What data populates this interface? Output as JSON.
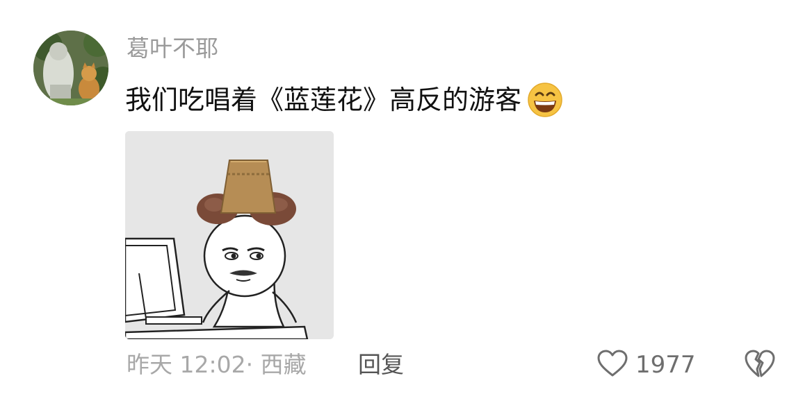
{
  "comment": {
    "username": "葛叶不耶",
    "text": "我们吃唱着《蓝莲花》高反的游客",
    "emoji": "grinning-face-emoji",
    "timestamp": "昨天 12:02· 西藏",
    "reply_label": "回复",
    "like_count": "1977",
    "icons": {
      "like": "heart-outline-icon",
      "dislike": "broken-heart-icon"
    },
    "colors": {
      "username": "#9a9a9a",
      "text": "#111111",
      "meta": "#a8a8a8",
      "reply": "#555555",
      "emoji": "#f6c343"
    }
  }
}
